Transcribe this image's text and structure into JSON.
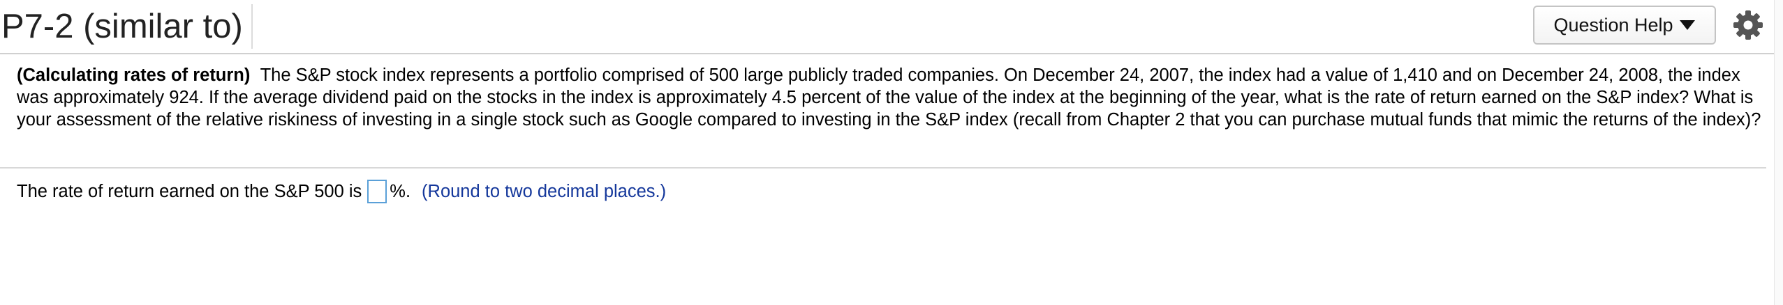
{
  "header": {
    "title": "P7-2 (similar to)",
    "help_button_label": "Question Help",
    "help_caret_icon": "caret-down-icon",
    "settings_icon": "gear-icon"
  },
  "question": {
    "topic": "(Calculating rates of return)",
    "text": "The S&P stock index represents a portfolio comprised of 500 large publicly traded companies.  On December 24, 2007, the index had a value of 1,410 and on December 24, 2008, the index was approximately 924.  If the average dividend paid on the stocks in the index is approximately 4.5 percent of the value of the index at the beginning of the year, what is the rate of return earned on the S&P index?  What is your assessment of the relative riskiness of investing in a single stock such as Google compared to investing in the S&P index (recall from Chapter 2 that you can purchase mutual funds that mimic the returns of the index)?"
  },
  "answer": {
    "prompt": "The rate of return earned on the S&P 500 is",
    "value": "",
    "unit": "%.",
    "hint": "(Round to two decimal places.)"
  },
  "colors": {
    "hint_text": "#14379b",
    "input_border": "#5aa0d8"
  }
}
